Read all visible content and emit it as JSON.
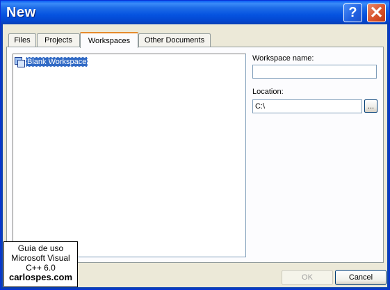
{
  "window": {
    "title": "New"
  },
  "titlebar": {
    "help_symbol": "?",
    "close_symbol": "✕"
  },
  "tabs": [
    {
      "label": "Files"
    },
    {
      "label": "Projects"
    },
    {
      "label": "Workspaces",
      "active": true
    },
    {
      "label": "Other Documents"
    }
  ],
  "list": {
    "items": [
      {
        "label": "Blank Workspace",
        "icon": "workspace-icon",
        "selected": true
      }
    ]
  },
  "form": {
    "workspace_name_label": "Workspace name:",
    "workspace_name_value": "",
    "location_label": "Location:",
    "location_value": "C:\\",
    "browse_label": "..."
  },
  "buttons": {
    "ok": "OK",
    "cancel": "Cancel"
  },
  "watermark": {
    "line1": "Guía de uso",
    "line2": "Microsoft Visual",
    "line3": "C++ 6.0",
    "site": "carlospes.com"
  },
  "colors": {
    "titlebar": "#0553E0",
    "selection": "#316AC5",
    "active_tab_accent": "#E68B2C",
    "dialog_bg": "#ECE9D8"
  }
}
